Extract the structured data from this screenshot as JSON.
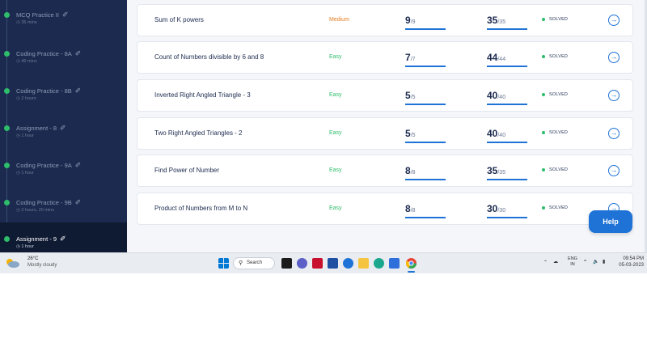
{
  "sidebar": {
    "items": [
      {
        "title": "MCQ Practice II",
        "meta": "35 mins",
        "active": false
      },
      {
        "title": "Coding Practice - 8A",
        "meta": "45 mins",
        "active": false
      },
      {
        "title": "Coding Practice - 8B",
        "meta": "2 hours",
        "active": false
      },
      {
        "title": "Assignment - 8",
        "meta": "1 hour",
        "active": false
      },
      {
        "title": "Coding Practice - 9A",
        "meta": "1 hour",
        "active": false
      },
      {
        "title": "Coding Practice - 9B",
        "meta": "2 hours, 20 mins",
        "active": false
      },
      {
        "title": "Assignment - 9",
        "meta": "1 hour",
        "active": true
      }
    ]
  },
  "problems": [
    {
      "name": "Sum of K powers",
      "difficulty": "Medium",
      "diff_color": "#e67e22",
      "test_passed": "9",
      "test_total": "/9",
      "score": "35",
      "score_total": "/35",
      "test_progress": 1.0,
      "score_progress": 1.0,
      "status": "SOLVED"
    },
    {
      "name": "Count of Numbers divisible by 6 and 8",
      "difficulty": "Easy",
      "diff_color": "#2ebd6b",
      "test_passed": "7",
      "test_total": "/7",
      "score": "44",
      "score_total": "/44",
      "test_progress": 1.0,
      "score_progress": 1.0,
      "status": "SOLVED"
    },
    {
      "name": "Inverted Right Angled Triangle - 3",
      "difficulty": "Easy",
      "diff_color": "#2ebd6b",
      "test_passed": "5",
      "test_total": "/5",
      "score": "40",
      "score_total": "/40",
      "test_progress": 1.0,
      "score_progress": 1.0,
      "status": "SOLVED"
    },
    {
      "name": "Two Right Angled Triangles - 2",
      "difficulty": "Easy",
      "diff_color": "#2ebd6b",
      "test_passed": "5",
      "test_total": "/5",
      "score": "40",
      "score_total": "/40",
      "test_progress": 1.0,
      "score_progress": 1.0,
      "status": "SOLVED"
    },
    {
      "name": "Find Power of Number",
      "difficulty": "Easy",
      "diff_color": "#2ebd6b",
      "test_passed": "8",
      "test_total": "/8",
      "score": "35",
      "score_total": "/35",
      "test_progress": 1.0,
      "score_progress": 1.0,
      "status": "SOLVED"
    },
    {
      "name": "Product of Numbers from M to N",
      "difficulty": "Easy",
      "diff_color": "#2ebd6b",
      "test_passed": "8",
      "test_total": "/8",
      "score": "30",
      "score_total": "/30",
      "test_progress": 1.0,
      "score_progress": 1.0,
      "status": "SOLVED"
    }
  ],
  "help_label": "Help",
  "icons": {
    "sidebar_pen": "pencil-icon",
    "sidebar_time": "clock-icon",
    "row_action": "arrow-circle-right-icon",
    "status": "green-dot-icon"
  },
  "colors": {
    "sidebar_bg": "#1b2a4e",
    "accent": "#1f73d6",
    "success": "#2ebd6b",
    "medium": "#e67e22"
  },
  "taskbar": {
    "weather_temp": "26°C",
    "weather_cond": "Mostly cloudy",
    "search_label": "Search",
    "lang_top": "ENG",
    "lang_bottom": "IN",
    "time": "09:54 PM",
    "date": "05-03-2023"
  }
}
